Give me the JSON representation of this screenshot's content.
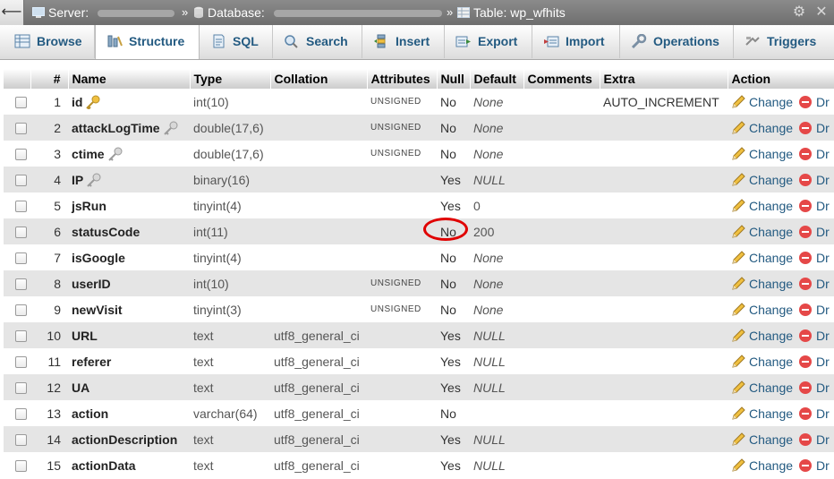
{
  "breadcrumb": {
    "server_label": "Server:",
    "database_label": "Database:",
    "table_label": "Table: wp_wfhits",
    "separator": "»"
  },
  "tabs": [
    {
      "label": "Browse",
      "icon": "browse-icon"
    },
    {
      "label": "Structure",
      "icon": "structure-icon",
      "active": true
    },
    {
      "label": "SQL",
      "icon": "sql-icon"
    },
    {
      "label": "Search",
      "icon": "search-icon"
    },
    {
      "label": "Insert",
      "icon": "insert-icon"
    },
    {
      "label": "Export",
      "icon": "export-icon"
    },
    {
      "label": "Import",
      "icon": "import-icon"
    },
    {
      "label": "Operations",
      "icon": "operations-icon"
    },
    {
      "label": "Triggers",
      "icon": "triggers-icon"
    }
  ],
  "table": {
    "headers": {
      "num": "#",
      "name": "Name",
      "type": "Type",
      "collation": "Collation",
      "attributes": "Attributes",
      "null": "Null",
      "default": "Default",
      "comments": "Comments",
      "extra": "Extra",
      "action": "Action"
    },
    "change_label": "Change",
    "drop_label": "Dr",
    "rows": [
      {
        "num": "1",
        "name": "id",
        "key": "primary",
        "type": "int(10)",
        "collation": "",
        "attr": "UNSIGNED",
        "null": "No",
        "default": "None",
        "extra": "AUTO_INCREMENT"
      },
      {
        "num": "2",
        "name": "attackLogTime",
        "key": "index",
        "type": "double(17,6)",
        "collation": "",
        "attr": "UNSIGNED",
        "null": "No",
        "default": "None",
        "extra": ""
      },
      {
        "num": "3",
        "name": "ctime",
        "key": "index",
        "type": "double(17,6)",
        "collation": "",
        "attr": "UNSIGNED",
        "null": "No",
        "default": "None",
        "extra": ""
      },
      {
        "num": "4",
        "name": "IP",
        "key": "index",
        "type": "binary(16)",
        "collation": "",
        "attr": "",
        "null": "Yes",
        "default": "NULL",
        "extra": ""
      },
      {
        "num": "5",
        "name": "jsRun",
        "key": "",
        "type": "tinyint(4)",
        "collation": "",
        "attr": "",
        "null": "Yes",
        "default": "0",
        "extra": ""
      },
      {
        "num": "6",
        "name": "statusCode",
        "key": "",
        "type": "int(11)",
        "collation": "",
        "attr": "",
        "null": "No",
        "default": "200",
        "extra": ""
      },
      {
        "num": "7",
        "name": "isGoogle",
        "key": "",
        "type": "tinyint(4)",
        "collation": "",
        "attr": "",
        "null": "No",
        "default": "None",
        "extra": ""
      },
      {
        "num": "8",
        "name": "userID",
        "key": "",
        "type": "int(10)",
        "collation": "",
        "attr": "UNSIGNED",
        "null": "No",
        "default": "None",
        "extra": ""
      },
      {
        "num": "9",
        "name": "newVisit",
        "key": "",
        "type": "tinyint(3)",
        "collation": "",
        "attr": "UNSIGNED",
        "null": "No",
        "default": "None",
        "extra": ""
      },
      {
        "num": "10",
        "name": "URL",
        "key": "",
        "type": "text",
        "collation": "utf8_general_ci",
        "attr": "",
        "null": "Yes",
        "default": "NULL",
        "extra": ""
      },
      {
        "num": "11",
        "name": "referer",
        "key": "",
        "type": "text",
        "collation": "utf8_general_ci",
        "attr": "",
        "null": "Yes",
        "default": "NULL",
        "extra": ""
      },
      {
        "num": "12",
        "name": "UA",
        "key": "",
        "type": "text",
        "collation": "utf8_general_ci",
        "attr": "",
        "null": "Yes",
        "default": "NULL",
        "extra": ""
      },
      {
        "num": "13",
        "name": "action",
        "key": "",
        "type": "varchar(64)",
        "collation": "utf8_general_ci",
        "attr": "",
        "null": "No",
        "default": "",
        "extra": ""
      },
      {
        "num": "14",
        "name": "actionDescription",
        "key": "",
        "type": "text",
        "collation": "utf8_general_ci",
        "attr": "",
        "null": "Yes",
        "default": "NULL",
        "extra": ""
      },
      {
        "num": "15",
        "name": "actionData",
        "key": "",
        "type": "text",
        "collation": "utf8_general_ci",
        "attr": "",
        "null": "Yes",
        "default": "NULL",
        "extra": ""
      }
    ]
  },
  "colors": {
    "link": "#235a81",
    "highlight_circle": "#e00000",
    "row_alt": "#e5e5e5",
    "topbar": "#7a7a7a"
  }
}
